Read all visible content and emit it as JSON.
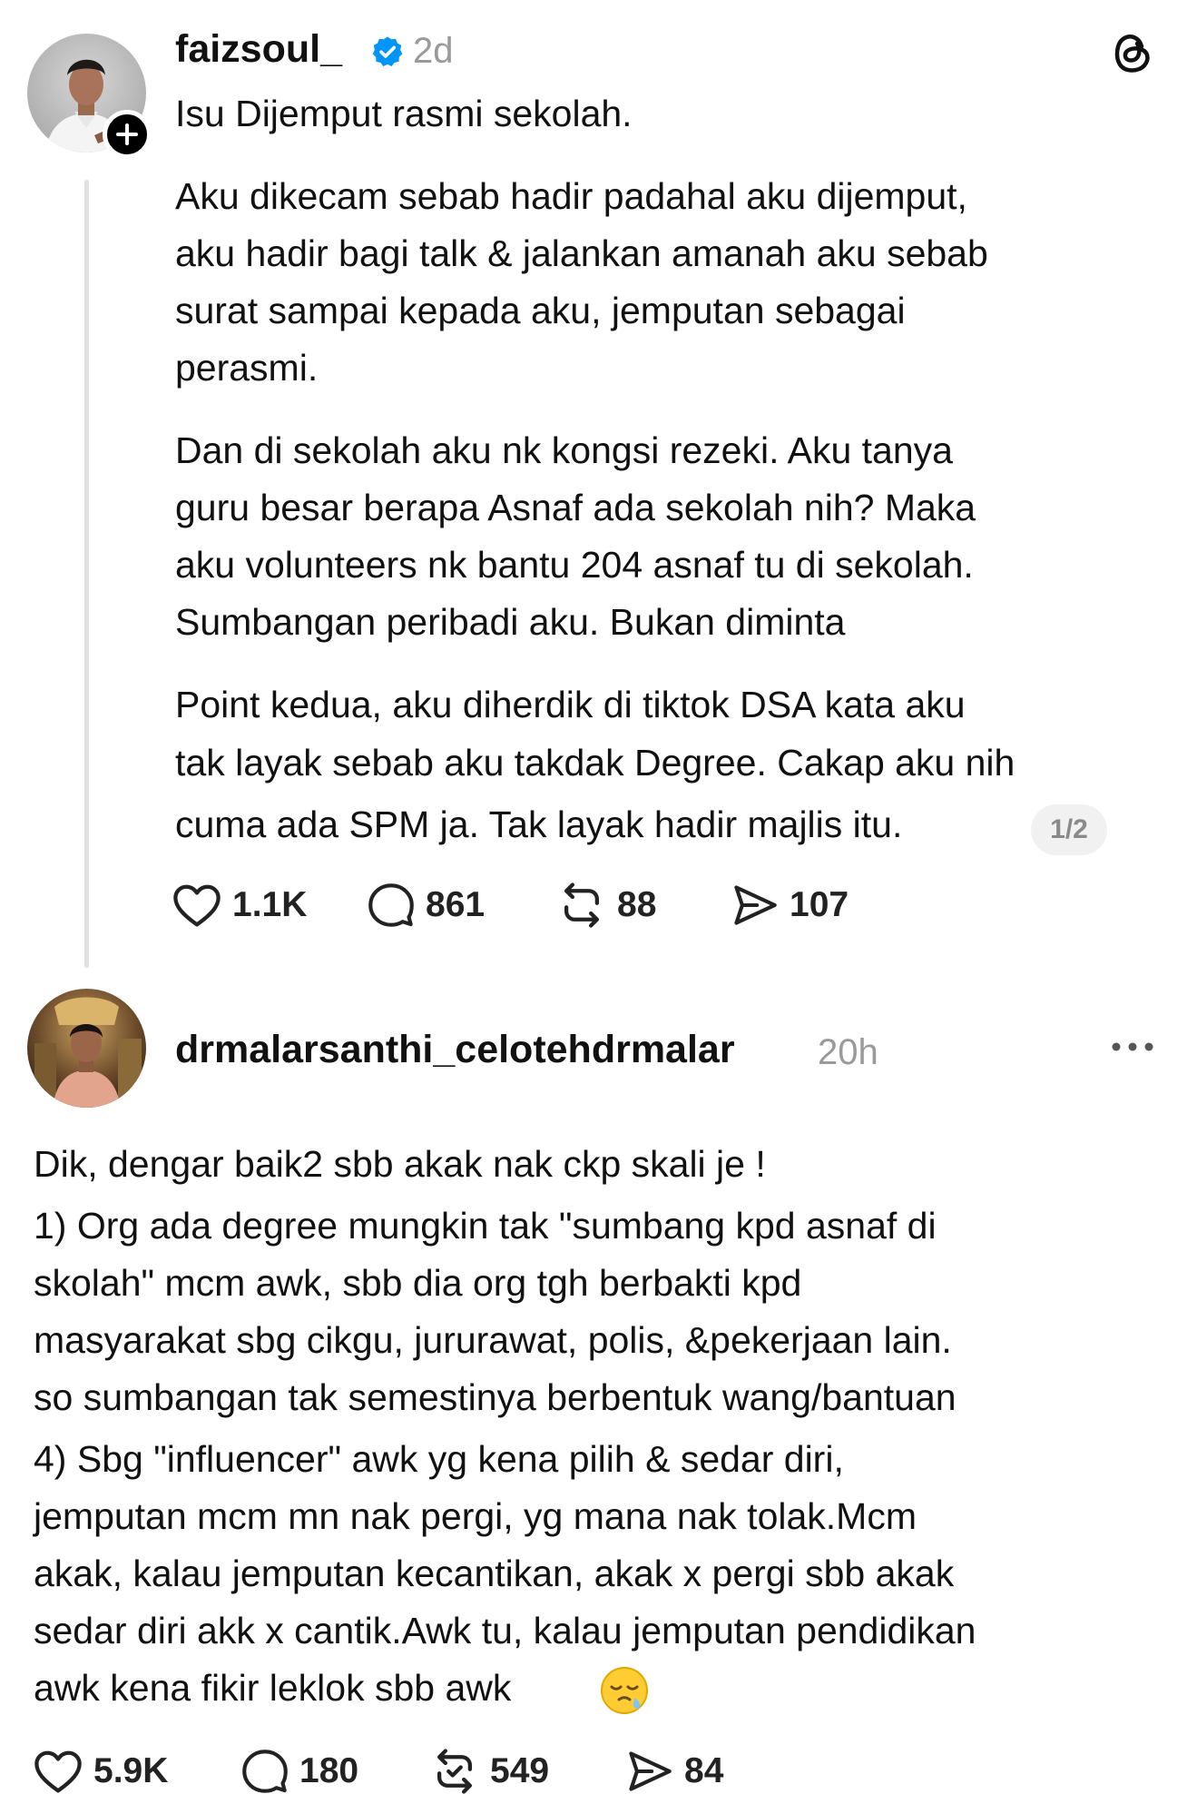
{
  "post1": {
    "username": "faizsoul_",
    "time": "2d",
    "headline": "Isu Dijemput rasmi sekolah.",
    "body_lines": [
      "Aku dikecam sebab hadir padahal aku dijemput,",
      "aku hadir bagi talk & jalankan amanah aku sebab",
      "surat sampai kepada aku, jemputan sebagai",
      "perasmi.",
      "Dan di sekolah aku nk kongsi rezeki. Aku tanya",
      "guru besar berapa Asnaf ada sekolah nih? Maka",
      "aku volunteers nk bantu 204 asnaf tu di sekolah.",
      "Sumbangan peribadi aku. Bukan diminta",
      "Point kedua, aku diherdik di tiktok DSA kata aku",
      "tak layak sebab aku takdak Degree. Cakap aku nih",
      "cuma ada SPM ja. Tak layak hadir majlis itu."
    ],
    "page_indicator": "1/2",
    "likes": "1.1K",
    "replies": "861",
    "reposts": "88",
    "shares": "107"
  },
  "post2": {
    "username": "drmalarsanthi_celotehdrmalar",
    "time": "20h",
    "body_lines": [
      "Dik, dengar baik2 sbb akak nak ckp skali je !",
      "1) Org ada degree mungkin tak \"sumbang kpd asnaf di",
      "skolah\" mcm awk, sbb dia org tgh berbakti kpd",
      "masyarakat sbg cikgu, jururawat, polis, &pekerjaan lain.",
      "so sumbangan tak semestinya berbentuk wang/bantuan",
      "4) Sbg \"influencer\" awk yg kena pilih & sedar diri,",
      "jemputan mcm mn nak pergi, yg mana nak tolak.Mcm",
      "akak, kalau jemputan kecantikan, akak x pergi sbb akak",
      "sedar diri akk x cantik.Awk tu, kalau jemputan pendidikan",
      "awk kena fikir leklok sbb awk"
    ],
    "likes": "5.9K",
    "replies": "180",
    "reposts": "549",
    "shares": "84"
  },
  "colors": {
    "text": "#111111",
    "muted": "#9a9a9a",
    "verified": "#0095f6",
    "thread_line": "#e1e1e1"
  },
  "icons": [
    "verified-badge-icon",
    "threads-logo-icon",
    "plus-icon",
    "heart-icon",
    "comment-icon",
    "repost-icon",
    "share-icon",
    "more-icon",
    "sleepy-face-emoji-icon"
  ]
}
